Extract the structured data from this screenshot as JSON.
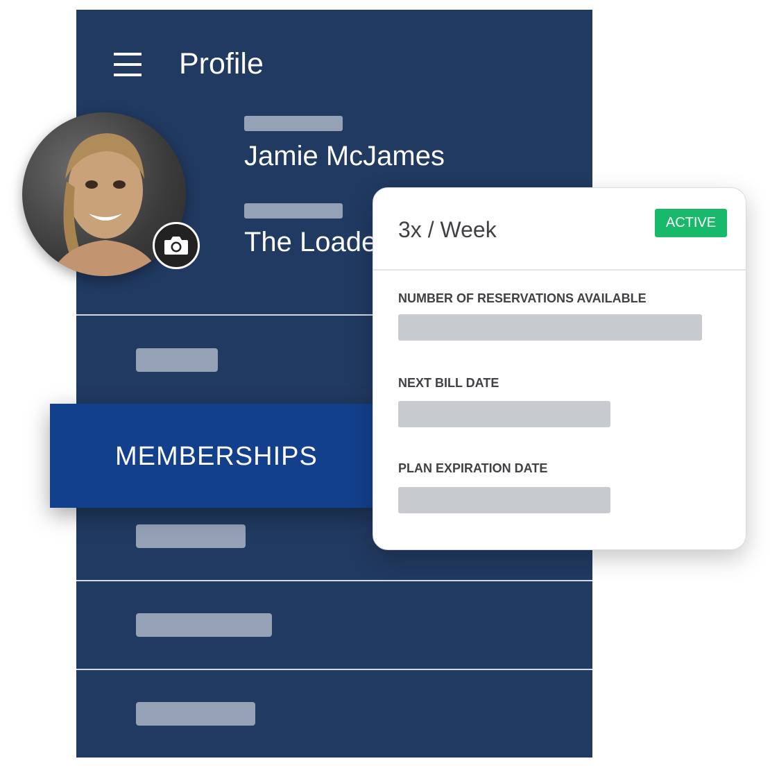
{
  "header": {
    "title": "Profile",
    "menu_icon": "hamburger-menu-icon"
  },
  "profile": {
    "name": "Jamie McJames",
    "gym_name": "The Loade",
    "avatar_icon": "user-photo",
    "camera_icon": "camera-icon"
  },
  "menu": {
    "active_item": "MEMBERSHIPS"
  },
  "membership_card": {
    "plan": "3x / Week",
    "status": "ACTIVE",
    "fields": [
      {
        "label": "NUMBER OF RESERVATIONS AVAILABLE"
      },
      {
        "label": "NEXT BILL DATE"
      },
      {
        "label": "PLAN EXPIRATION DATE"
      }
    ]
  },
  "colors": {
    "panel": "#213a61",
    "active_tab": "#13408c",
    "active_badge": "#19b96b",
    "placeholder": "#95a1b5"
  }
}
